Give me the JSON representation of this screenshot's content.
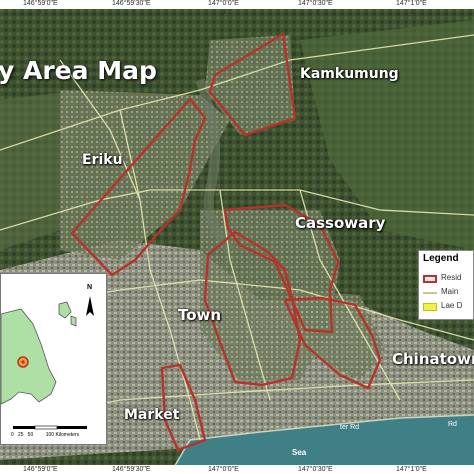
{
  "map_title": "y Area Map",
  "coordinates_top": [
    "146°59'0\"E",
    "146°59'30\"E",
    "147°0'0\"E",
    "147°0'30\"E",
    "147°1'0\"E"
  ],
  "coordinates_bottom": [
    "146°59'0\"E",
    "146°59'30\"E",
    "147°0'0\"E",
    "147°0'30\"E",
    "147°1'0\"E"
  ],
  "places": {
    "kamkumung": "Kamkumung",
    "eriku": "Eriku",
    "cassowary": "Cassowary",
    "town": "Town",
    "chinatown": "Chinatown",
    "market": "Market",
    "sea": "Sea"
  },
  "legend": {
    "title": "Legend",
    "items": [
      {
        "label": "Resid",
        "color": "#b8322c",
        "style": "outline"
      },
      {
        "label": "Main",
        "color": "#e8e8b0",
        "style": "line"
      },
      {
        "label": "Lae D",
        "color": "#f0f040",
        "style": "fill"
      }
    ]
  },
  "inset": {
    "scale_label": "0   25   50         100 Kilometers",
    "north_symbol": "N"
  },
  "road_labels": [
    "ter Rd",
    "Rd"
  ],
  "colors": {
    "boundary": "#b8322c",
    "vegetation_dark": "#2f4226",
    "vegetation_light": "#5b6e44",
    "urban": "#9a9a8c",
    "sea": "#3f7f86",
    "inset_land": "#aee0a6"
  }
}
